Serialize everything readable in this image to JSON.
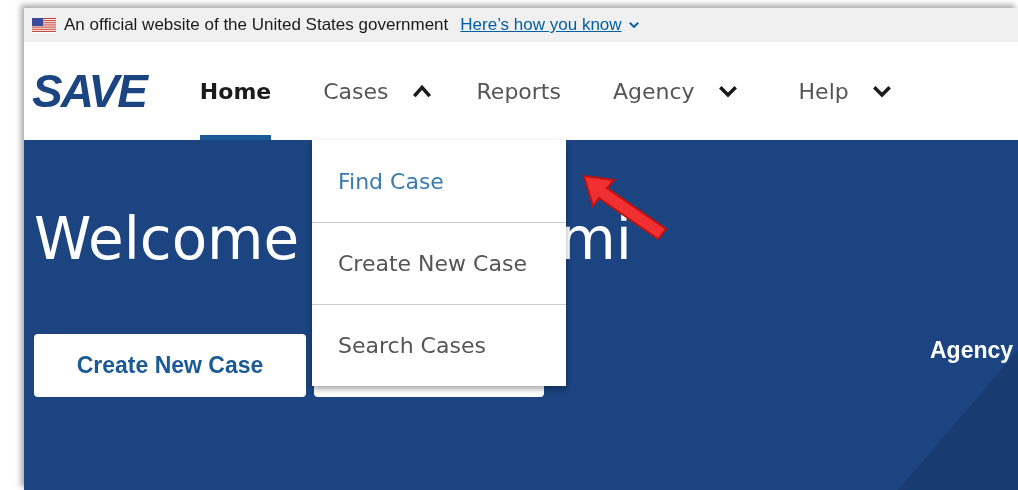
{
  "gov_banner": {
    "text": "An official website of the United States government",
    "link": "Here’s how you know"
  },
  "logo": {
    "text": "SAVE"
  },
  "nav": [
    {
      "label": "Home",
      "selected": true,
      "has_menu": false,
      "expanded": false
    },
    {
      "label": "Cases",
      "selected": false,
      "has_menu": true,
      "expanded": true
    },
    {
      "label": "Reports",
      "selected": false,
      "has_menu": false,
      "expanded": false
    },
    {
      "label": "Agency",
      "selected": false,
      "has_menu": true,
      "expanded": false
    },
    {
      "label": "Help",
      "selected": false,
      "has_menu": true,
      "expanded": false
    }
  ],
  "dropdown": [
    {
      "label": "Find Case",
      "selected": true
    },
    {
      "label": "Create New Case",
      "selected": false
    },
    {
      "label": "Search Cases",
      "selected": false
    }
  ],
  "hero": {
    "title_start": "Welcome",
    "title_end": "mi",
    "button": "Create New Case",
    "side_label": "Agency"
  }
}
